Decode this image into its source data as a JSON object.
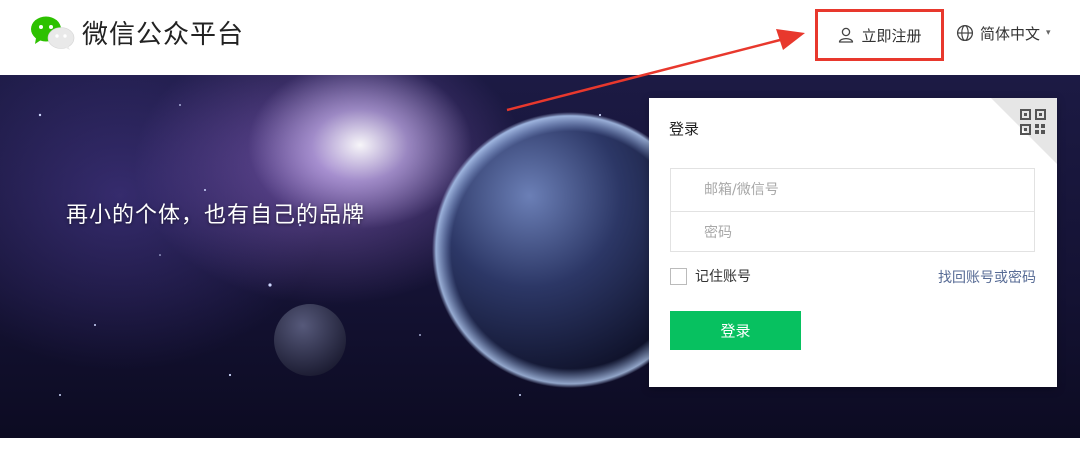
{
  "header": {
    "logo_text": "微信公众平台",
    "logo_icon": "wechat-bubbles-icon",
    "register_label": "立即注册",
    "register_icon": "user-icon",
    "language_label": "简体中文",
    "language_icon": "globe-icon",
    "language_caret": "▾"
  },
  "banner": {
    "slogan": "再小的个体，也有自己的品牌"
  },
  "login": {
    "title": "登录",
    "qr_icon": "qr-code-icon",
    "account_placeholder": "邮箱/微信号",
    "password_placeholder": "密码",
    "remember_label": "记住账号",
    "forgot_label": "找回账号或密码",
    "login_button": "登录"
  },
  "colors": {
    "brand_green": "#07c160",
    "annotation_red": "#e8382d",
    "link_blue": "#576b95"
  }
}
